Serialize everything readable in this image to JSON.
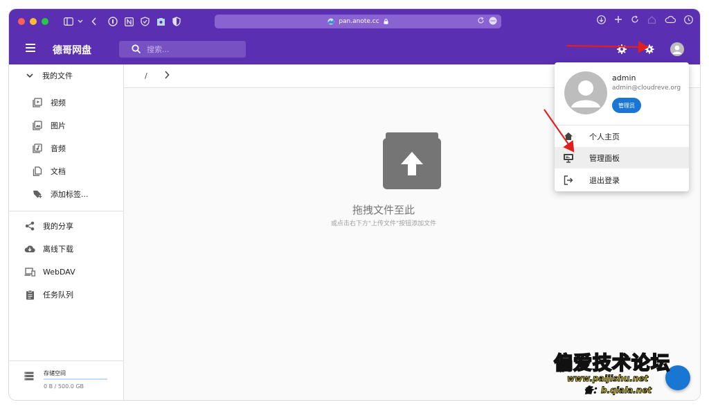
{
  "browser": {
    "url": "pan.anote.cc"
  },
  "header": {
    "title": "德哥网盘",
    "search_placeholder": "搜索..."
  },
  "sidebar": {
    "my_files": "我的文件",
    "items": [
      {
        "label": "视频",
        "icon": "video-icon"
      },
      {
        "label": "图片",
        "icon": "image-icon"
      },
      {
        "label": "音频",
        "icon": "audio-icon"
      },
      {
        "label": "文档",
        "icon": "document-icon"
      },
      {
        "label": "添加标签...",
        "icon": "add-tag-icon"
      }
    ],
    "nav": [
      {
        "label": "我的分享",
        "icon": "share-icon"
      },
      {
        "label": "离线下载",
        "icon": "cloud-download-icon"
      },
      {
        "label": "WebDAV",
        "icon": "webdav-icon"
      },
      {
        "label": "任务队列",
        "icon": "task-queue-icon"
      }
    ],
    "storage": {
      "label": "存储空间",
      "value": "0 B / 500.0 GB",
      "used_fraction": 0
    }
  },
  "main": {
    "breadcrumb_root": "/",
    "empty_title": "拖拽文件至此",
    "empty_subtitle": "或点击右下方\"上传文件\"按钮添加文件"
  },
  "user_menu": {
    "name": "admin",
    "email": "admin@cloudreve.org",
    "role": "管理员",
    "items": [
      {
        "label": "个人主页",
        "icon": "home-icon"
      },
      {
        "label": "管理面板",
        "icon": "admin-panel-icon"
      },
      {
        "label": "退出登录",
        "icon": "logout-icon"
      }
    ]
  },
  "watermark": {
    "line1": "偏爱技术论坛",
    "line2": "www.paijishu.net",
    "line3": "备：b.qiala.net"
  },
  "colors": {
    "primary": "#5b2fb2",
    "accent": "#1976d2",
    "annotation": "#e02020"
  }
}
